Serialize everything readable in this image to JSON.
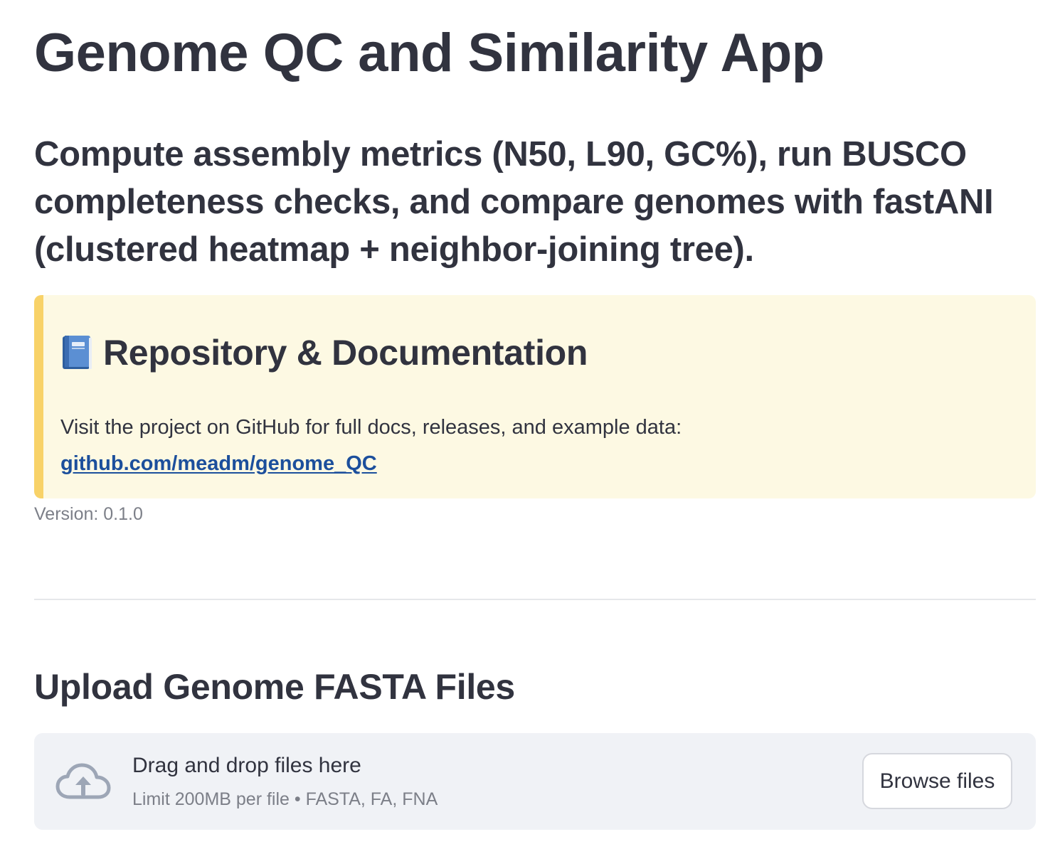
{
  "page": {
    "title": "Genome QC and Similarity App",
    "subtitle": "Compute assembly metrics (N50, L90, GC%), run BUSCO completeness checks, and compare genomes with fastANI (clustered heatmap + neighbor-joining tree)."
  },
  "callout": {
    "icon": "blue-book-icon",
    "title": "Repository & Documentation",
    "text": "Visit the project on GitHub for full docs, releases, and example data: ",
    "link_label": "github.com/meadm/genome_QC",
    "background_color": "#fdf9e3",
    "accent_color": "#f8d268",
    "link_color": "#1c4f9c"
  },
  "version": {
    "label": "Version: 0.1.0"
  },
  "upload": {
    "section_title": "Upload Genome FASTA Files",
    "icon": "cloud-upload-icon",
    "drop_label": "Drag and drop files here",
    "limit_text": "Limit 200MB per file • FASTA, FA, FNA",
    "browse_button_label": "Browse files"
  }
}
